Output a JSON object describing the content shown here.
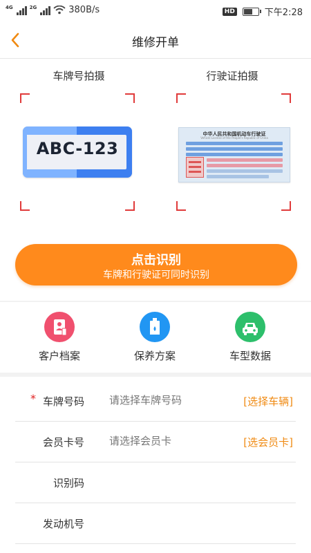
{
  "status_bar": {
    "net1": "4G",
    "net2": "2G",
    "speed": "380B/s",
    "hd": "HD",
    "time": "下午2:28",
    "battery_level": 0.55
  },
  "nav": {
    "title": "维修开单"
  },
  "scan": {
    "plate_label": "车牌号拍摄",
    "license_label": "行驶证拍摄",
    "plate_text": "ABC-123",
    "license_title": "中华人民共和国机动车行驶证",
    "license_subtitle": "Vehicle License of the People's Republic of China"
  },
  "recognize": {
    "title": "点击识别",
    "subtitle": "车牌和行驶证可同时识别"
  },
  "quick_actions": [
    {
      "label": "客户档案",
      "icon": "customer-file-icon",
      "color": "#f0506e"
    },
    {
      "label": "保养方案",
      "icon": "oil-bottle-icon",
      "color": "#2196f3"
    },
    {
      "label": "车型数据",
      "icon": "car-icon",
      "color": "#2dbf6b"
    }
  ],
  "form": {
    "plate": {
      "label": "车牌号码",
      "required_mark": "*",
      "placeholder": "请选择车牌号码",
      "action": "[选择车辆]"
    },
    "member": {
      "label": "会员卡号",
      "placeholder": "请选择会员卡",
      "action": "[选会员卡]"
    },
    "vin": {
      "label": "识别码"
    },
    "engine": {
      "label": "发动机号"
    }
  },
  "colors": {
    "accent": "#ff8a1c",
    "scan_corner": "#e03a3a",
    "action_text": "#f08a12"
  }
}
